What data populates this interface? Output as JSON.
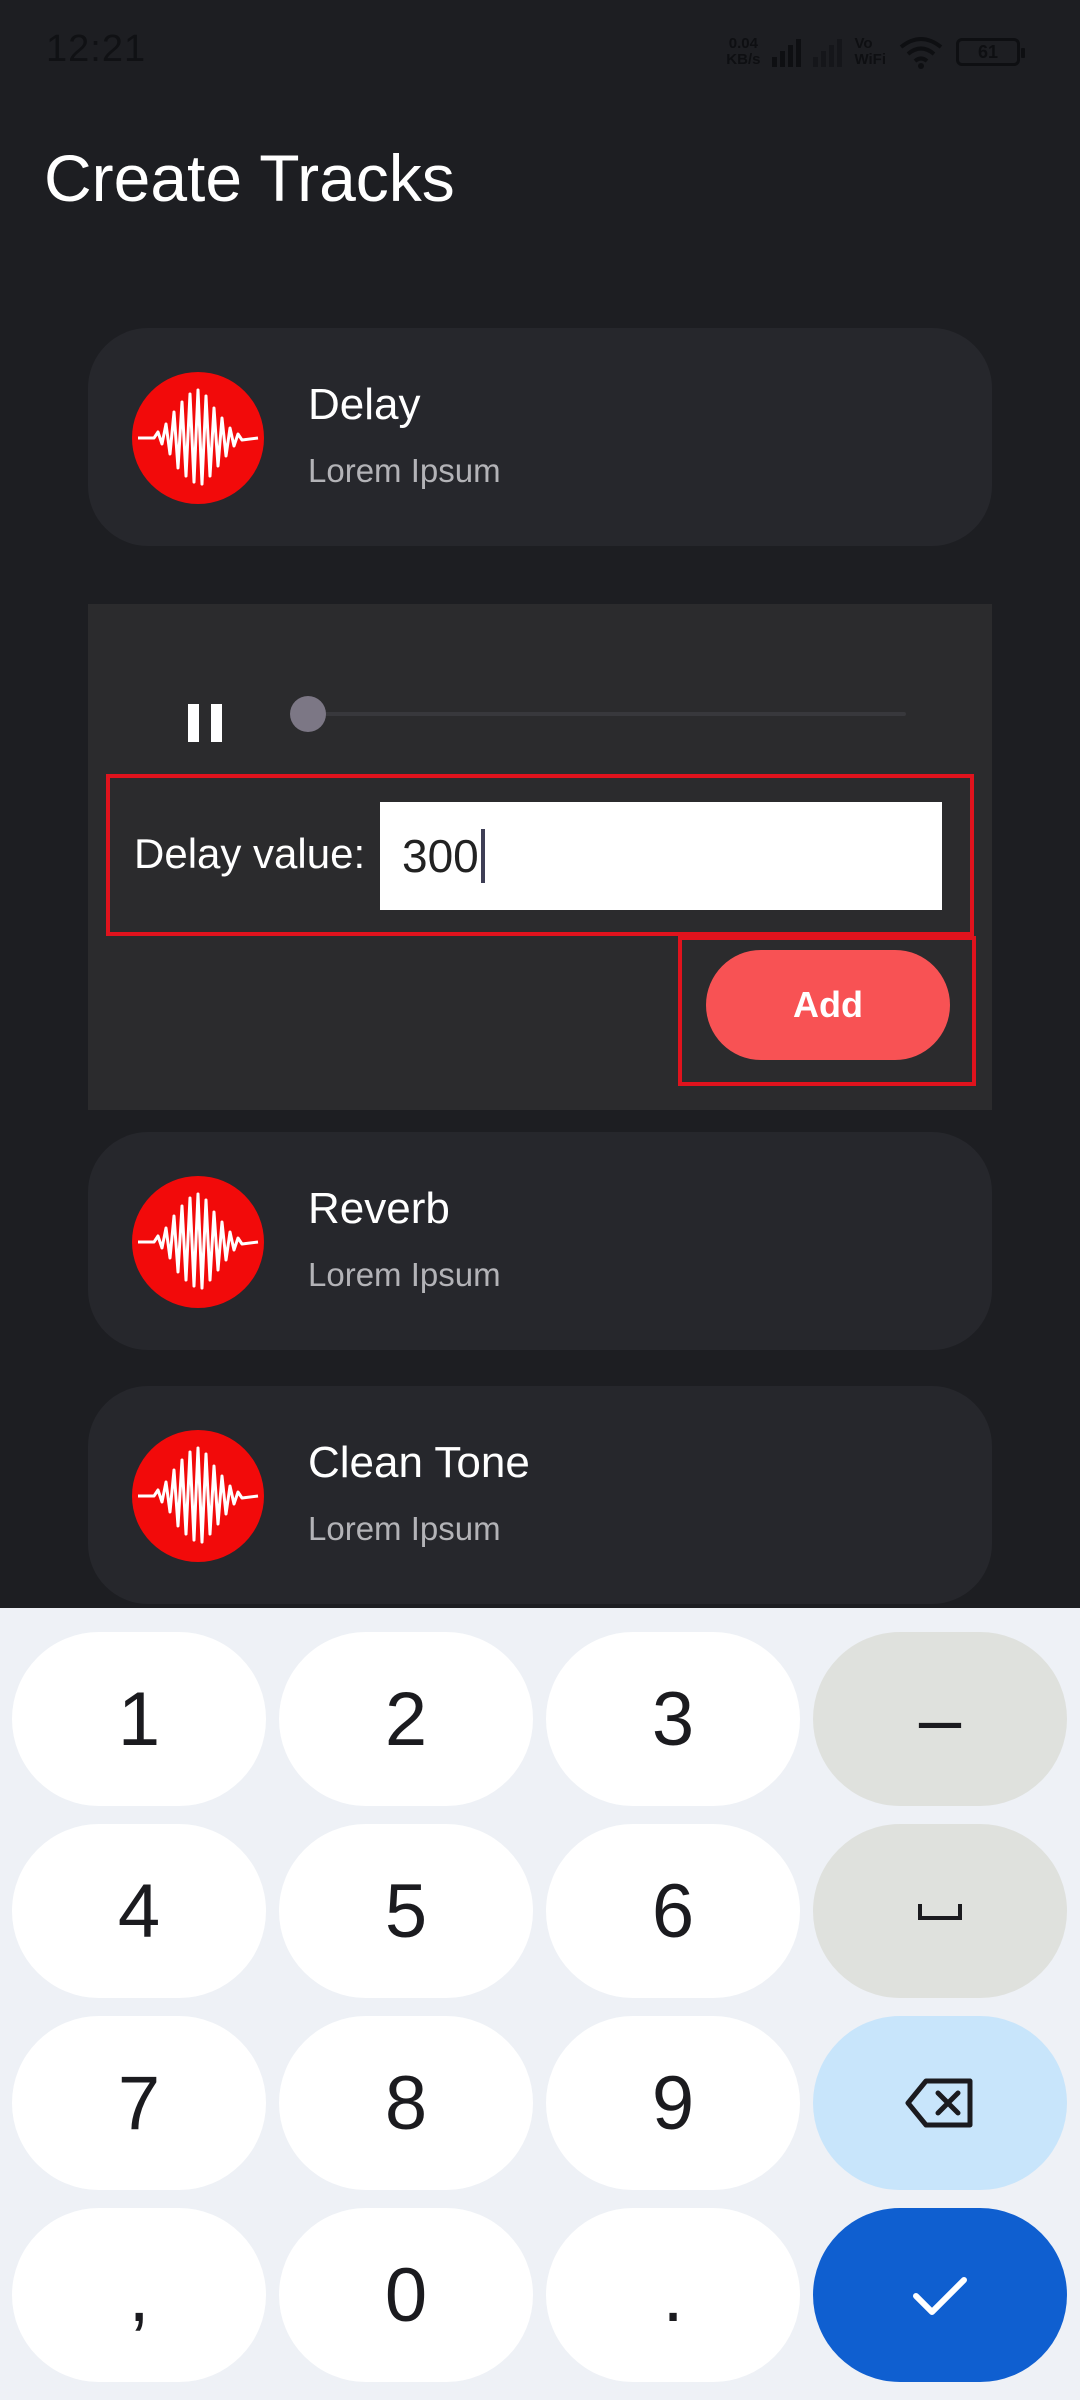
{
  "status_bar": {
    "time": "12:21",
    "net_speed_value": "0.04",
    "net_speed_unit": "KB/s",
    "vowifi_top": "Vo",
    "vowifi_bottom": "WiFi",
    "battery": "61"
  },
  "page": {
    "title": "Create Tracks"
  },
  "tracks": [
    {
      "name": "Delay",
      "subtitle": "Lorem Ipsum"
    },
    {
      "name": "Reverb",
      "subtitle": "Lorem Ipsum"
    },
    {
      "name": "Clean Tone",
      "subtitle": "Lorem Ipsum"
    }
  ],
  "player": {
    "playing": true,
    "progress": 0.0,
    "delay_label": "Delay value:",
    "delay_value": "300",
    "add_label": "Add"
  },
  "keyboard": {
    "keys": [
      "1",
      "2",
      "3",
      "–",
      "4",
      "5",
      "6",
      "␣",
      "7",
      "8",
      "9",
      "backspace",
      ",",
      "0",
      ".",
      "done"
    ]
  },
  "colors": {
    "background": "#1d1e22",
    "card": "#26272c",
    "avatar": "#f20a0a",
    "accent": "#f85254",
    "highlight_border": "#e0131d",
    "keyboard_done": "#0f5fd0"
  }
}
